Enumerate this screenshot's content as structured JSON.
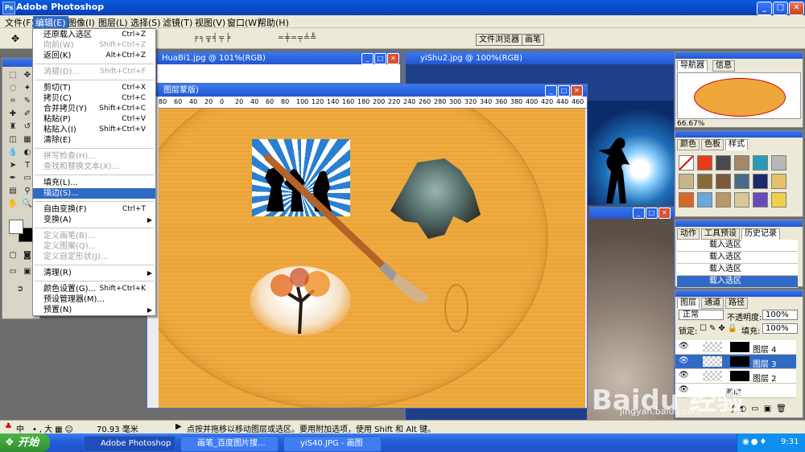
{
  "app": {
    "title": "Adobe Photoshop"
  },
  "menubar": [
    "文件(F)",
    "编辑(E)",
    "图像(I)",
    "图层(L)",
    "选择(S)",
    "滤镜(T)",
    "视图(V)",
    "窗口(W)",
    "帮助(H)"
  ],
  "optbar": {
    "file_browser": "文件浏览器",
    "brushes": "画笔"
  },
  "edit_menu": [
    {
      "label": "还原载入选区",
      "shortcut": "Ctrl+Z",
      "disabled": false
    },
    {
      "label": "向前(W)",
      "shortcut": "Shift+Ctrl+Z",
      "disabled": true
    },
    {
      "label": "返回(K)",
      "shortcut": "Alt+Ctrl+Z",
      "disabled": false
    },
    {
      "label": "消褪(D)...",
      "shortcut": "Shift+Ctrl+F",
      "disabled": true
    },
    {
      "label": "剪切(T)",
      "shortcut": "Ctrl+X",
      "disabled": false
    },
    {
      "label": "拷贝(C)",
      "shortcut": "Ctrl+C",
      "disabled": false
    },
    {
      "label": "合并拷贝(Y)",
      "shortcut": "Shift+Ctrl+C",
      "disabled": false
    },
    {
      "label": "粘贴(P)",
      "shortcut": "Ctrl+V",
      "disabled": false
    },
    {
      "label": "粘贴入(I)",
      "shortcut": "Shift+Ctrl+V",
      "disabled": false
    },
    {
      "label": "清除(E)",
      "shortcut": "",
      "disabled": false
    },
    {
      "label": "拼写检查(H)...",
      "shortcut": "",
      "disabled": true
    },
    {
      "label": "查找和替换文本(X)...",
      "shortcut": "",
      "disabled": true
    },
    {
      "label": "填充(L)...",
      "shortcut": "",
      "disabled": false
    },
    {
      "label": "描边(S)...",
      "shortcut": "",
      "disabled": false
    },
    {
      "label": "自由变换(F)",
      "shortcut": "Ctrl+T",
      "disabled": false
    },
    {
      "label": "变换(A)",
      "shortcut": "",
      "disabled": false
    },
    {
      "label": "定义画笔(B)...",
      "shortcut": "",
      "disabled": true
    },
    {
      "label": "定义图案(Q)...",
      "shortcut": "",
      "disabled": true
    },
    {
      "label": "定义自定形状(J)...",
      "shortcut": "",
      "disabled": true
    },
    {
      "label": "清理(R)",
      "shortcut": "",
      "disabled": false
    },
    {
      "label": "颜色设置(G)...",
      "shortcut": "Shift+Ctrl+K",
      "disabled": false
    },
    {
      "label": "预设管理器(M)...",
      "shortcut": "",
      "disabled": false
    },
    {
      "label": "预置(N)",
      "shortcut": "",
      "disabled": false
    }
  ],
  "docs": {
    "huabi": "HuaBi1.jpg @ 101%(RGB)",
    "yishu": "yiShu2.jpg @ 100%(RGB)",
    "main": "图层蒙版)"
  },
  "ruler_ticks": [
    "80",
    "60",
    "40",
    "20",
    "0",
    "20",
    "40",
    "60",
    "80",
    "100",
    "120",
    "140",
    "160",
    "180",
    "200",
    "220",
    "240",
    "260",
    "280",
    "300",
    "320",
    "340",
    "360",
    "380",
    "400",
    "420",
    "440",
    "460"
  ],
  "navigator": {
    "tabs": [
      "导航器",
      "信息"
    ],
    "zoom": "66.67%"
  },
  "color_panel": {
    "tabs": [
      "颜色",
      "色板",
      "样式"
    ]
  },
  "history": {
    "tabs": [
      "动作",
      "工具预设",
      "历史记录"
    ],
    "items": [
      "载入选区",
      "载入选区",
      "载入选区",
      "载入选区"
    ]
  },
  "layers": {
    "tabs": [
      "图层",
      "通道",
      "路径"
    ],
    "blend": "正常",
    "opacity_label": "不透明度:",
    "opacity": "100%",
    "lock_label": "锁定:",
    "fill_label": "填充:",
    "fill": "100%",
    "items": [
      "图层 4",
      "图层 3",
      "图层 2",
      "图层"
    ]
  },
  "status": {
    "size": "70.93 毫米",
    "hint": "点按并拖移以移动图层或选区。要用附加选项，使用 Shift 和 Alt 键。",
    "ime": "中"
  },
  "taskbar": {
    "start": "开始",
    "tasks": [
      "Adobe Photoshop",
      "画笔_百度图片搜...",
      "yiS40.JPG - 画图"
    ],
    "time": "9:31"
  },
  "watermark": "jingyan.baidu.com",
  "colors": {
    "canvas": "#eea63b",
    "accent": "#316ac5"
  }
}
